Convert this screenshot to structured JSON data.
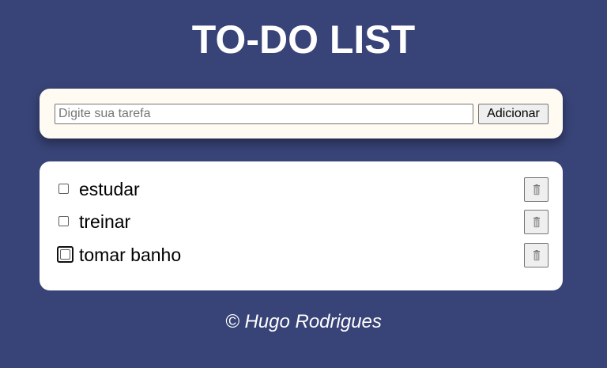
{
  "header": {
    "title": "TO-DO LIST"
  },
  "input_form": {
    "placeholder": "Digite sua tarefa",
    "value": "",
    "add_button_label": "Adicionar"
  },
  "tasks": [
    {
      "label": "estudar",
      "checked": false,
      "delete_icon": "trash-icon"
    },
    {
      "label": "treinar",
      "checked": false,
      "delete_icon": "trash-icon"
    },
    {
      "label": "tomar banho",
      "checked": false,
      "delete_icon": "trash-icon"
    }
  ],
  "footer": {
    "copyright": "© Hugo Rodrigues"
  },
  "colors": {
    "background": "#384377",
    "input_card": "#fffbf2",
    "list_card": "#ffffff",
    "text_light": "#ffffff"
  }
}
